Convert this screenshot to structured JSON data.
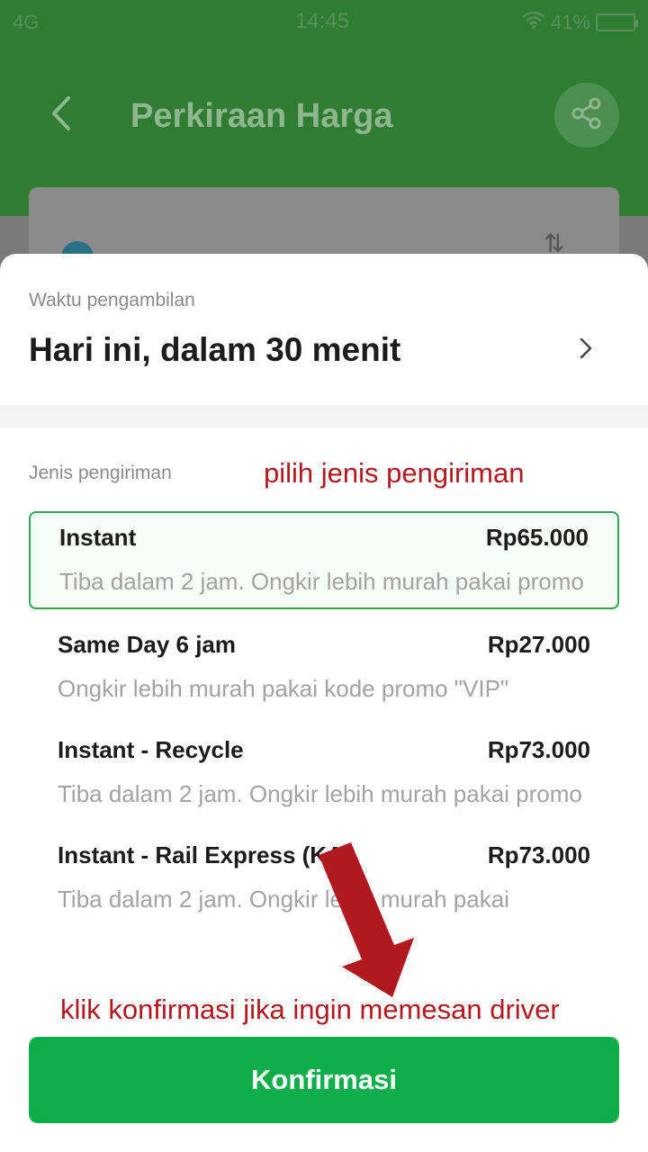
{
  "status_bar": {
    "network": "4G",
    "time": "14:45",
    "battery": "41%"
  },
  "header": {
    "title": "Perkiraan Harga",
    "back_icon": "chevron-left-icon",
    "share_icon": "share-icon"
  },
  "pickup": {
    "label": "Waktu pengambilan",
    "value": "Hari ini, dalam 30 menit"
  },
  "delivery": {
    "label": "Jenis pengiriman",
    "options": [
      {
        "name": "Instant",
        "price": "Rp65.000",
        "desc": "Tiba dalam 2 jam. Ongkir lebih murah pakai promo",
        "selected": true
      },
      {
        "name": "Same Day 6 jam",
        "price": "Rp27.000",
        "desc": "Ongkir lebih murah pakai kode promo \"VIP\"",
        "selected": false
      },
      {
        "name": "Instant - Recycle",
        "price": "Rp73.000",
        "desc": "Tiba dalam 2 jam. Ongkir lebih murah pakai promo",
        "selected": false
      },
      {
        "name": "Instant - Rail Express (KA",
        "price": "Rp73.000",
        "desc": "Tiba dalam 2 jam. Ongkir lebih murah pakai",
        "selected": false
      }
    ]
  },
  "annotations": {
    "top": "pilih jenis pengiriman",
    "bottom": "klik konfirmasi jika ingin memesan driver"
  },
  "confirm_button": {
    "label": "Konfirmasi"
  },
  "colors": {
    "primary_green": "#0fae4b",
    "annotation_red": "#b0191f",
    "selected_border": "#2fa84f"
  }
}
